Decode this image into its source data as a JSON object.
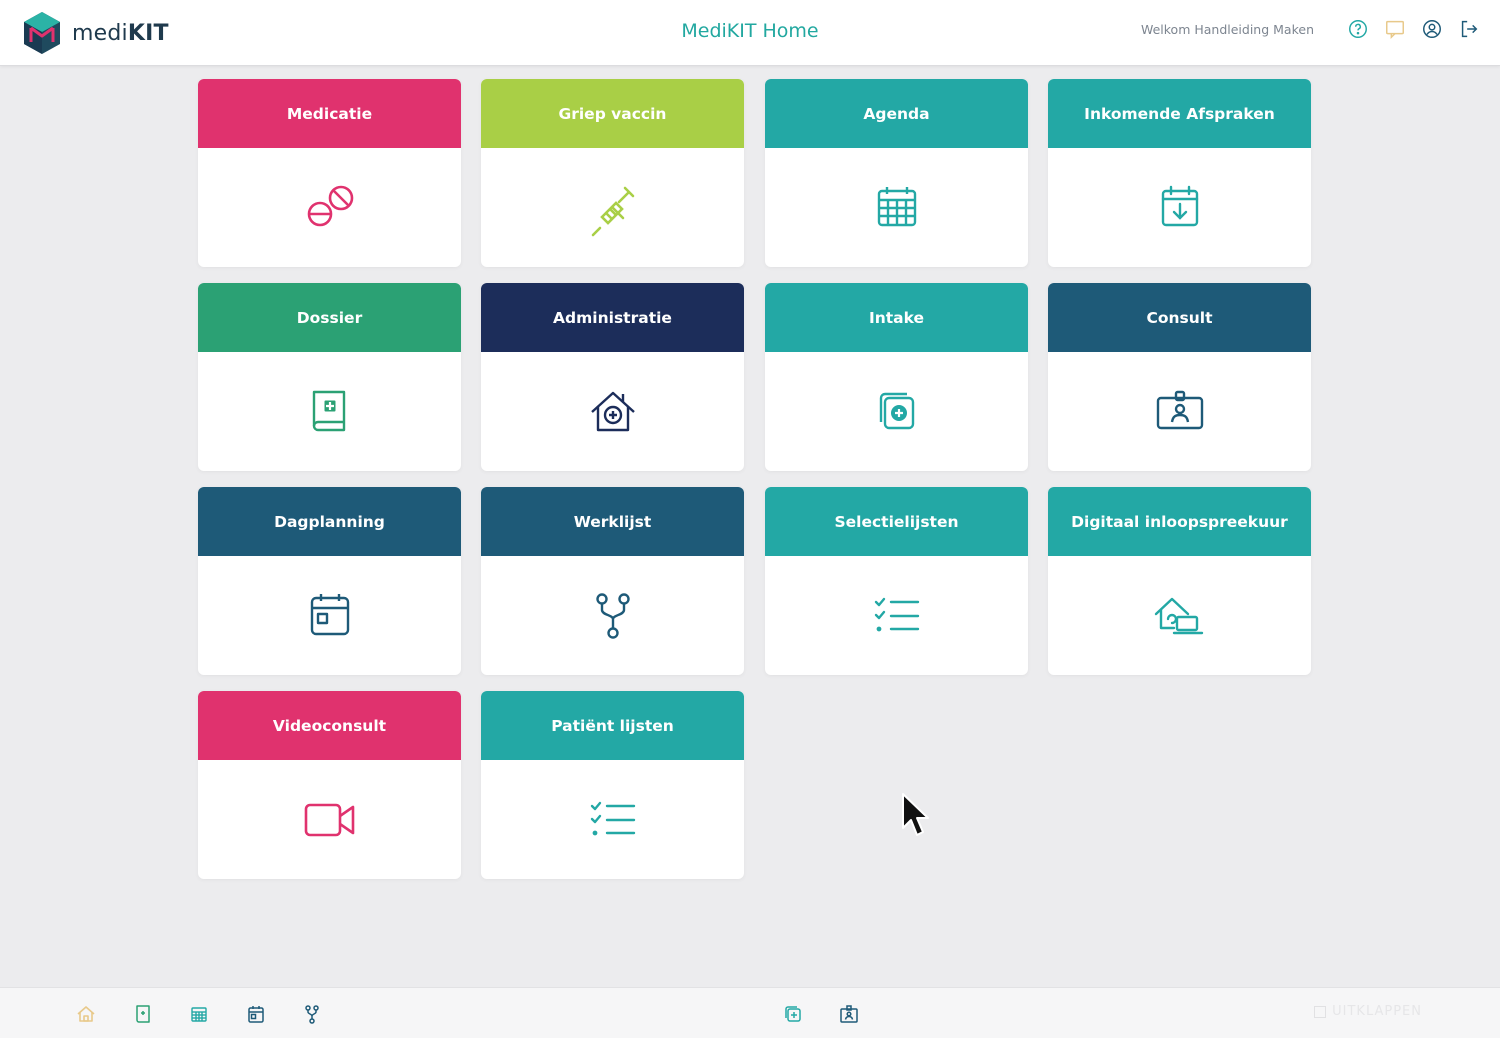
{
  "header": {
    "brand_prefix": "medi",
    "brand_suffix": "KIT",
    "title": "MediKIT Home",
    "welcome": "Welkom Handleiding Maken",
    "icons": [
      "help-icon",
      "chat-icon",
      "user-icon",
      "logout-icon"
    ]
  },
  "tiles": [
    {
      "label": "Medicatie",
      "icon": "pills-icon",
      "color": "#e0326e"
    },
    {
      "label": "Griep vaccin",
      "icon": "syringe-icon",
      "color": "#a9cf46"
    },
    {
      "label": "Agenda",
      "icon": "calendar-grid-icon",
      "color": "#23a8a5"
    },
    {
      "label": "Inkomende Afspraken",
      "icon": "calendar-download-icon",
      "color": "#23a8a5"
    },
    {
      "label": "Dossier",
      "icon": "medical-book-icon",
      "color": "#2ba174"
    },
    {
      "label": "Administratie",
      "icon": "medical-house-icon",
      "color": "#1c2d5a"
    },
    {
      "label": "Intake",
      "icon": "copy-plus-icon",
      "color": "#23a8a5"
    },
    {
      "label": "Consult",
      "icon": "id-badge-icon",
      "color": "#1e5a78"
    },
    {
      "label": "Dagplanning",
      "icon": "calendar-day-icon",
      "color": "#1e5a78"
    },
    {
      "label": "Werklijst",
      "icon": "workflow-icon",
      "color": "#1e5a78"
    },
    {
      "label": "Selectielijsten",
      "icon": "checklist-icon",
      "color": "#23a8a5"
    },
    {
      "label": "Digitaal inloopspreekuur",
      "icon": "home-laptop-icon",
      "color": "#23a8a5"
    },
    {
      "label": "Videoconsult",
      "icon": "video-camera-icon",
      "color": "#e0326e"
    },
    {
      "label": "Patiënt lijsten",
      "icon": "checklist-icon",
      "color": "#23a8a5"
    }
  ],
  "bottom_bar": {
    "icons": [
      "home-icon",
      "dossier-icon",
      "agenda-icon",
      "dagplanning-icon",
      "werklijst-icon",
      "intake-icon",
      "consult-icon"
    ],
    "right_label": "UITKLAPPEN"
  }
}
